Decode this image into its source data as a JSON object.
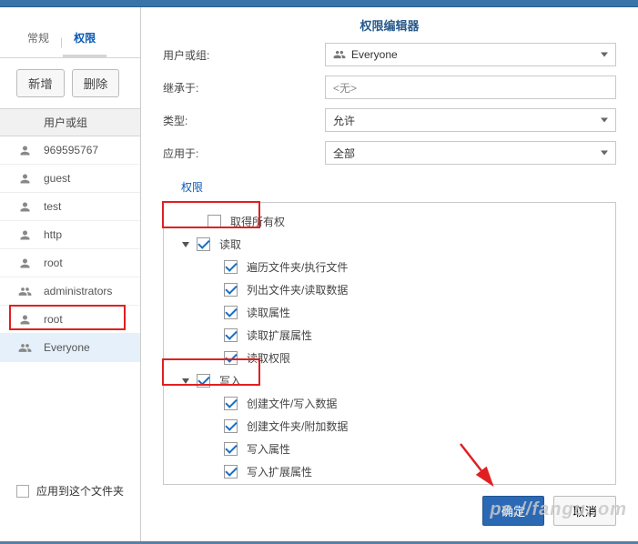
{
  "tabs": {
    "general": "常规",
    "permissions": "权限"
  },
  "toolbar": {
    "add": "新增",
    "delete": "删除"
  },
  "list_header": "用户或组",
  "users": [
    {
      "name": "969595767",
      "type": "user"
    },
    {
      "name": "guest",
      "type": "user"
    },
    {
      "name": "test",
      "type": "user"
    },
    {
      "name": "http",
      "type": "user"
    },
    {
      "name": "root",
      "type": "user"
    },
    {
      "name": "administrators",
      "type": "group"
    },
    {
      "name": "root",
      "type": "user"
    },
    {
      "name": "Everyone",
      "type": "group"
    }
  ],
  "apply_checkbox_label": "应用到这个文件夹",
  "dialog": {
    "title": "权限编辑器",
    "fields": {
      "user_or_group": {
        "label": "用户或组:",
        "value": "Everyone"
      },
      "inherit_from": {
        "label": "继承于:",
        "value": "<无>"
      },
      "type": {
        "label": "类型:",
        "value": "允许"
      },
      "apply_to": {
        "label": "应用于:",
        "value": "全部"
      }
    },
    "perm_header": "权限",
    "perms": {
      "take_ownership": {
        "label": "取得所有权",
        "checked": false
      },
      "read": {
        "label": "读取",
        "checked": true,
        "children": [
          {
            "label": "遍历文件夹/执行文件",
            "checked": true
          },
          {
            "label": "列出文件夹/读取数据",
            "checked": true
          },
          {
            "label": "读取属性",
            "checked": true
          },
          {
            "label": "读取扩展属性",
            "checked": true
          },
          {
            "label": "读取权限",
            "checked": true
          }
        ]
      },
      "write": {
        "label": "写入",
        "checked": true,
        "children": [
          {
            "label": "创建文件/写入数据",
            "checked": true
          },
          {
            "label": "创建文件夹/附加数据",
            "checked": true
          },
          {
            "label": "写入属性",
            "checked": true
          },
          {
            "label": "写入扩展属性",
            "checked": true
          }
        ]
      }
    },
    "buttons": {
      "ok": "确定",
      "cancel": "取消"
    }
  },
  "watermark": "ps://fangu..om"
}
